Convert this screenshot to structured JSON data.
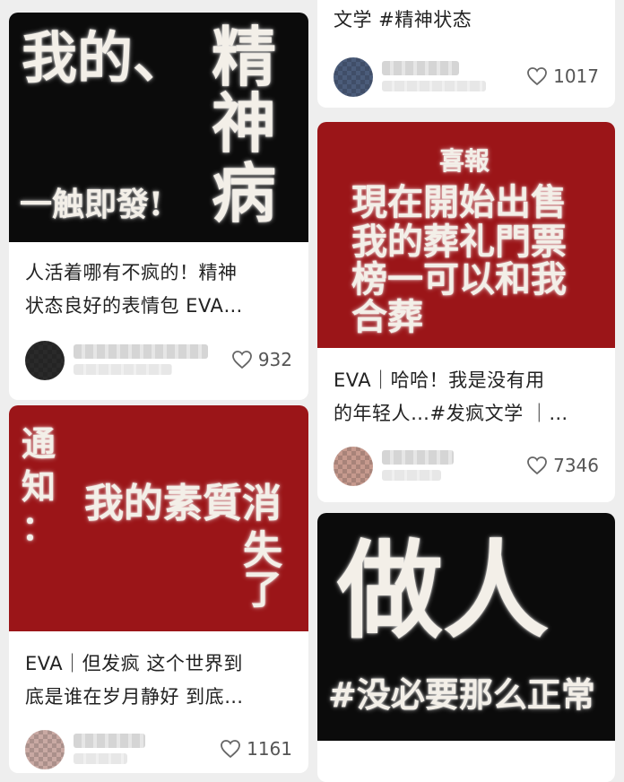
{
  "feed": {
    "left": [
      {
        "cover_lines": [
          "我的、",
          "精",
          "神",
          "病",
          "一触即發!"
        ],
        "title_lines": [
          "人活着哪有不疯的！精神",
          "状态良好的表情包 EVA…"
        ],
        "likes": "932",
        "avatar_color": "#2a2a2a"
      },
      {
        "cover_lines": [
          "通",
          "知",
          "：",
          "我的素質消",
          "失了"
        ],
        "title_lines": [
          "EVA｜但发疯 这个世界到",
          "底是谁在岁月静好 到底…"
        ],
        "likes": "1161",
        "avatar_color": "#c9a9a3"
      }
    ],
    "right": [
      {
        "title_tail": "文学 #精神状态",
        "likes": "1017",
        "avatar_color": "#4b5c7a"
      },
      {
        "cover_lines": [
          "喜報",
          "現在開始出售",
          "我的葬礼門票",
          "榜一可以和我",
          "合葬"
        ],
        "title_lines": [
          "EVA｜哈哈！我是没有用",
          "的年轻人…#发疯文学 ｜…"
        ],
        "likes": "7346",
        "avatar_color": "#c69a8e"
      },
      {
        "cover_lines": [
          "做人",
          "#没必要那么正常"
        ]
      }
    ]
  },
  "colors": {
    "dark_cover": "#0b0b0b",
    "red_cover": "#9b1518",
    "text": "#222222",
    "like_text": "#555555"
  },
  "icons": {
    "like": "heart-outline-icon"
  }
}
